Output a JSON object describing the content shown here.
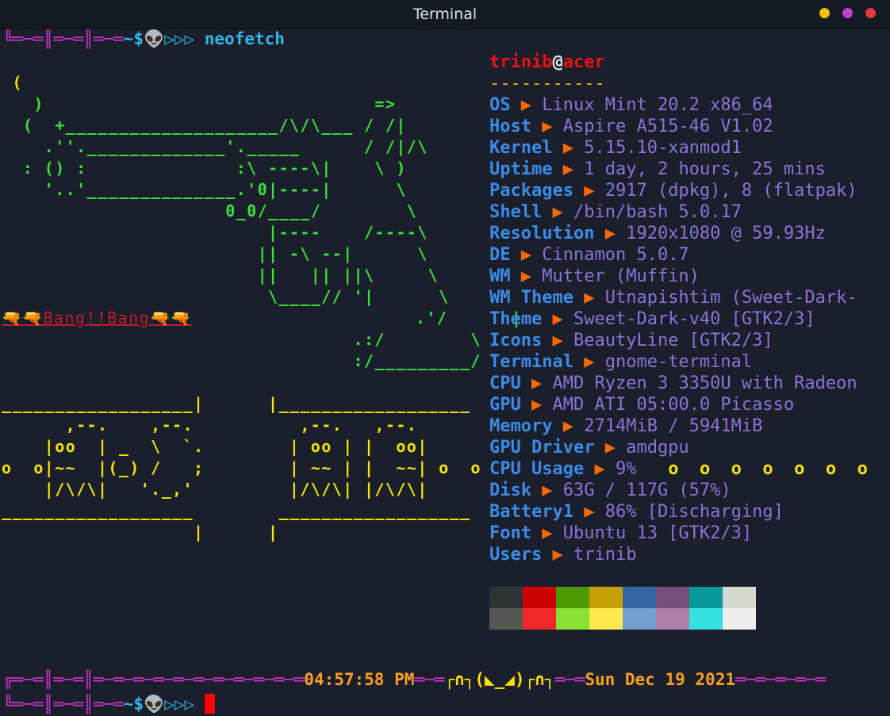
{
  "window": {
    "title": "Terminal",
    "buttons": [
      {
        "name": "minimize",
        "color": "#f0c000"
      },
      {
        "name": "maximize",
        "color": "#c040d0"
      },
      {
        "name": "close",
        "color": "#e53935"
      }
    ]
  },
  "prompt": {
    "frame": "╚═─═║═─═║═─═",
    "symbol": "~$",
    "alien": "👽",
    "arrows": "▷▷▷",
    "command": "neofetch"
  },
  "ascii_art": {
    "lines": [
      " (",
      "   )                               =>",
      "  (  +____________________/\\/\\___ / /|",
      "    .''._____________'._____      / /|/\\",
      "  : () :              :\\ ----\\|    \\ )",
      "    '..'______________.'0|----|      \\",
      "                     0_0/____/        \\",
      "                         |----    /----\\",
      "                        || -\\ --|      \\",
      "                        ||   || ||\\     \\",
      "                         \\____// '|      \\",
      "                                  .'/      |",
      "                                 .:/        \\",
      "                                 :/_________/",
      "",
      "__________________|      |__________________",
      "      ,--.    ,--.          ,--.   ,--.",
      "    |oo  | _  \\  `.        | oo | |  oo|",
      "o  o|~~  |(_) /   ;        | ~~ | |  ~~| o  o",
      "    |/\\/\\|   '._,'         |/\\/\\| |/\\/\\|",
      "__________________        __________________",
      "                  |      |"
    ],
    "bang_text": "🔫🔫Bang!!Bang🔫🔫"
  },
  "info": {
    "user": "trinib",
    "at": "@",
    "host": "acer",
    "separator": "-----------",
    "rows": [
      {
        "key": "OS",
        "value": "Linux Mint 20.2 x86_64"
      },
      {
        "key": "Host",
        "value": "Aspire A515-46 V1.02"
      },
      {
        "key": "Kernel",
        "value": "5.15.10-xanmod1"
      },
      {
        "key": "Uptime",
        "value": "1 day, 2 hours, 25 mins"
      },
      {
        "key": "Packages",
        "value": "2917 (dpkg), 8 (flatpak)"
      },
      {
        "key": "Shell",
        "value": "/bin/bash 5.0.17"
      },
      {
        "key": "Resolution",
        "value": "1920x1080 @ 59.93Hz"
      },
      {
        "key": "DE",
        "value": "Cinnamon 5.0.7"
      },
      {
        "key": "WM",
        "value": "Mutter (Muffin)"
      },
      {
        "key": "WM Theme",
        "value": "Utnapishtim (Sweet-Dark-"
      },
      {
        "key": "Theme",
        "value": "Sweet-Dark-v40 [GTK2/3]"
      },
      {
        "key": "Icons",
        "value": "BeautyLine [GTK2/3]"
      },
      {
        "key": "Terminal",
        "value": "gnome-terminal"
      },
      {
        "key": "CPU",
        "value": "AMD Ryzen 3 3350U with Radeon"
      },
      {
        "key": "GPU",
        "value": "AMD ATI 05:00.0 Picasso"
      },
      {
        "key": "Memory",
        "value": "2714MiB / 5941MiB"
      },
      {
        "key": "GPU Driver",
        "value": "amdgpu"
      },
      {
        "key": "CPU Usage",
        "value": "9%"
      },
      {
        "key": "Disk",
        "value": "63G / 117G (57%)"
      },
      {
        "key": "Battery1",
        "value": "86% [Discharging]"
      },
      {
        "key": "Font",
        "value": "Ubuntu 13 [GTK2/3]"
      },
      {
        "key": "Users",
        "value": "trinib"
      }
    ],
    "arrow": "▶",
    "cpu_trail": "   o  o  o  o  o  o  o",
    "palette_dark": [
      "#2e3436",
      "#cc0000",
      "#4e9a06",
      "#c4a000",
      "#3465a4",
      "#75507b",
      "#06989a",
      "#d3d7cf"
    ],
    "palette_bright": [
      "#555753",
      "#ef2929",
      "#8ae234",
      "#fce94f",
      "#729fcf",
      "#ad7fa8",
      "#34e2e2",
      "#eeeeec"
    ]
  },
  "status": {
    "frame_left": "╔═─═║═─═║═─═─═─═─═─═─═─═─═─═─═",
    "time": "04:57:58 PM",
    "mid_left": "═─═",
    "cat": "┌∩┐(◣_◢)┌∩┐",
    "mid_right": "═─═",
    "date": "Sun Dec 19 2021",
    "frame_right": "═─═─═─═─═"
  }
}
